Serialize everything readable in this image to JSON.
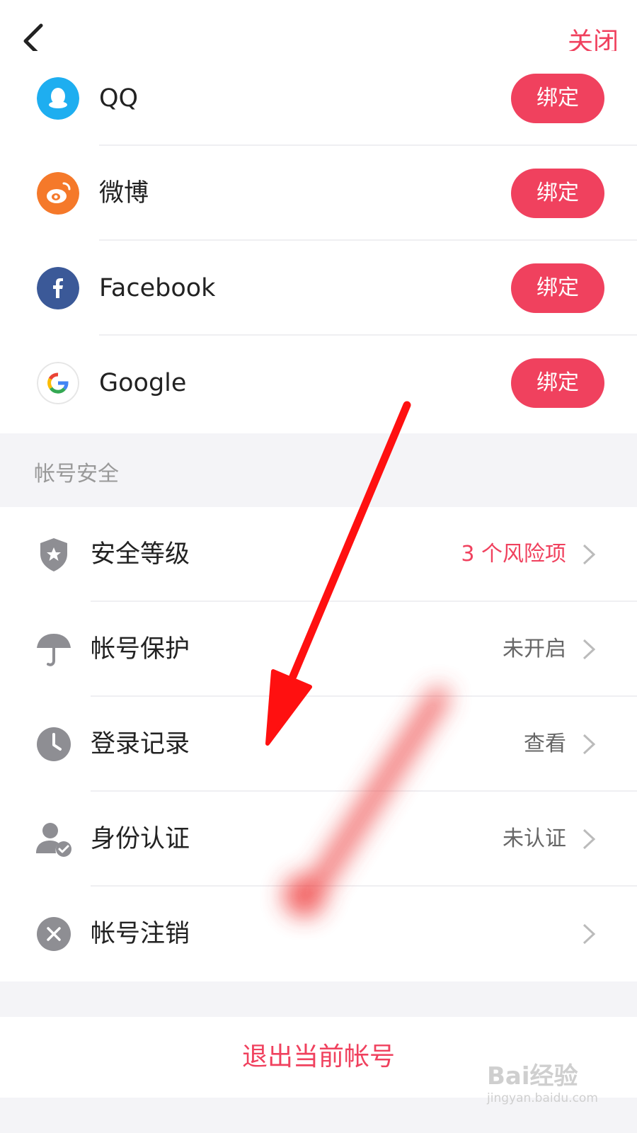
{
  "header": {
    "close_label": "关闭"
  },
  "bindings": [
    {
      "name": "QQ",
      "button": "绑定",
      "icon": "qq-icon",
      "color": "#1eaef0"
    },
    {
      "name": "微博",
      "button": "绑定",
      "icon": "weibo-icon",
      "color": "#f5792a"
    },
    {
      "name": "Facebook",
      "button": "绑定",
      "icon": "facebook-icon",
      "color": "#3b5998"
    },
    {
      "name": "Google",
      "button": "绑定",
      "icon": "google-icon",
      "color": "#ffffff"
    }
  ],
  "security": {
    "title": "帐号安全",
    "items": [
      {
        "label": "安全等级",
        "value": "3 个风险项",
        "icon": "shield-star-icon"
      },
      {
        "label": "帐号保护",
        "value": "未开启",
        "icon": "umbrella-icon"
      },
      {
        "label": "登录记录",
        "value": "查看",
        "icon": "clock-icon"
      },
      {
        "label": "身份认证",
        "value": "未认证",
        "icon": "user-check-icon"
      },
      {
        "label": "帐号注销",
        "value": "",
        "icon": "cancel-circle-icon"
      }
    ]
  },
  "logout_label": "退出当前帐号",
  "watermark": {
    "main": "Bai经验",
    "sub": "jingyan.baidu.com"
  },
  "colors": {
    "accent": "#f0415e",
    "icon_gray": "#8e8e93",
    "section_bg": "#f4f4f7"
  }
}
